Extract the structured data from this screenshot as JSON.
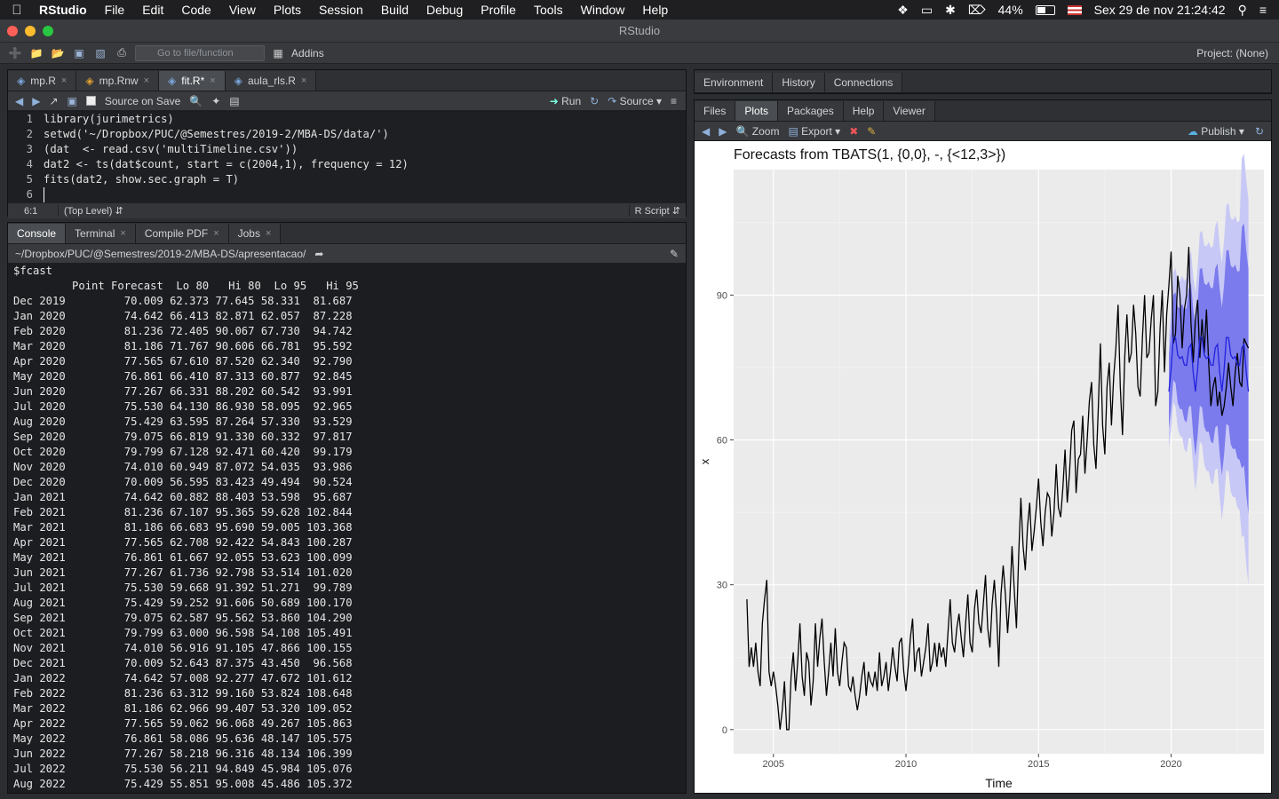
{
  "menubar": {
    "app": "RStudio",
    "items": [
      "File",
      "Edit",
      "Code",
      "View",
      "Plots",
      "Session",
      "Build",
      "Debug",
      "Profile",
      "Tools",
      "Window",
      "Help"
    ],
    "battery": "44%",
    "datetime": "Sex 29 de nov  21:24:42"
  },
  "window": {
    "title": "RStudio"
  },
  "toolbar": {
    "goto_placeholder": "Go to file/function",
    "addins": "Addins",
    "project": "Project: (None)"
  },
  "editor": {
    "tabs": [
      {
        "label": "mp.R"
      },
      {
        "label": "mp.Rnw"
      },
      {
        "label": "fit.R*"
      },
      {
        "label": "aula_rls.R"
      }
    ],
    "source_on_save": "Source on Save",
    "run": "Run",
    "source": "Source",
    "lines": [
      "1",
      "2",
      "3",
      "4",
      "5",
      "6"
    ],
    "code": [
      "library(jurimetrics)",
      "setwd('~/Dropbox/PUC/@Semestres/2019-2/MBA-DS/data/')",
      "(dat  <- read.csv('multiTimeline.csv'))",
      "dat2 <- ts(dat$count, start = c(2004,1), frequency = 12)",
      "fits(dat2, show.sec.graph = T)",
      ""
    ],
    "cursor_pos": "6:1",
    "scope": "(Top Level)",
    "filetype": "R Script"
  },
  "console": {
    "tabs": [
      {
        "label": "Console"
      },
      {
        "label": "Terminal"
      },
      {
        "label": "Compile PDF"
      },
      {
        "label": "Jobs"
      }
    ],
    "path": "~/Dropbox/PUC/@Semestres/2019-2/MBA-DS/apresentacao/",
    "lines": [
      "$fcast",
      "         Point Forecast  Lo 80   Hi 80  Lo 95   Hi 95",
      "Dec 2019         70.009 62.373 77.645 58.331  81.687",
      "Jan 2020         74.642 66.413 82.871 62.057  87.228",
      "Feb 2020         81.236 72.405 90.067 67.730  94.742",
      "Mar 2020         81.186 71.767 90.606 66.781  95.592",
      "Apr 2020         77.565 67.610 87.520 62.340  92.790",
      "May 2020         76.861 66.410 87.313 60.877  92.845",
      "Jun 2020         77.267 66.331 88.202 60.542  93.991",
      "Jul 2020         75.530 64.130 86.930 58.095  92.965",
      "Aug 2020         75.429 63.595 87.264 57.330  93.529",
      "Sep 2020         79.075 66.819 91.330 60.332  97.817",
      "Oct 2020         79.799 67.128 92.471 60.420  99.179",
      "Nov 2020         74.010 60.949 87.072 54.035  93.986",
      "Dec 2020         70.009 56.595 83.423 49.494  90.524",
      "Jan 2021         74.642 60.882 88.403 53.598  95.687",
      "Feb 2021         81.236 67.107 95.365 59.628 102.844",
      "Mar 2021         81.186 66.683 95.690 59.005 103.368",
      "Apr 2021         77.565 62.708 92.422 54.843 100.287",
      "May 2021         76.861 61.667 92.055 53.623 100.099",
      "Jun 2021         77.267 61.736 92.798 53.514 101.020",
      "Jul 2021         75.530 59.668 91.392 51.271  99.789",
      "Aug 2021         75.429 59.252 91.606 50.689 100.170",
      "Sep 2021         79.075 62.587 95.562 53.860 104.290",
      "Oct 2021         79.799 63.000 96.598 54.108 105.491",
      "Nov 2021         74.010 56.916 91.105 47.866 100.155",
      "Dec 2021         70.009 52.643 87.375 43.450  96.568",
      "Jan 2022         74.642 57.008 92.277 47.672 101.612",
      "Feb 2022         81.236 63.312 99.160 53.824 108.648",
      "Mar 2022         81.186 62.966 99.407 53.320 109.052",
      "Apr 2022         77.565 59.062 96.068 49.267 105.863",
      "May 2022         76.861 58.086 95.636 48.147 105.575",
      "Jun 2022         77.267 58.218 96.316 48.134 106.399",
      "Jul 2022         75.530 56.211 94.849 45.984 105.076",
      "Aug 2022         75.429 55.851 95.008 45.486 105.372"
    ]
  },
  "env_pane": {
    "tabs": [
      {
        "label": "Environment"
      },
      {
        "label": "History"
      },
      {
        "label": "Connections"
      }
    ]
  },
  "plots_pane": {
    "tabs": [
      {
        "label": "Files"
      },
      {
        "label": "Plots"
      },
      {
        "label": "Packages"
      },
      {
        "label": "Help"
      },
      {
        "label": "Viewer"
      }
    ],
    "zoom": "Zoom",
    "export": "Export",
    "publish": "Publish"
  },
  "chart_data": {
    "type": "line",
    "title": "Forecasts from TBATS(1, {0,0}, -, {<12,3>})",
    "xlabel": "Time",
    "ylabel": "x",
    "xlim": [
      2003.5,
      2023.5
    ],
    "ylim": [
      -5,
      116
    ],
    "xticks": [
      "2005",
      "2010",
      "2015",
      "2020"
    ],
    "yticks": [
      "0",
      "30",
      "60",
      "90"
    ],
    "grid": true,
    "colors": {
      "history": "#000000",
      "forecast": "#2222dd",
      "band80": "#7b7bee",
      "band95": "#c8c8f6",
      "panel": "#ebebeb"
    },
    "series": [
      {
        "start": 2004.0,
        "freq": 12,
        "values": [
          27,
          13,
          17,
          13,
          18,
          12,
          9,
          22,
          27,
          31,
          12,
          9,
          12,
          9,
          5,
          0,
          4,
          10,
          0,
          0,
          11,
          16,
          8,
          14,
          22,
          11,
          7,
          16,
          14,
          5,
          10,
          22,
          13,
          19,
          23,
          14,
          7,
          12,
          18,
          11,
          21,
          12,
          9,
          14,
          18,
          17,
          9,
          8,
          11,
          7,
          4,
          7,
          11,
          14,
          7,
          12,
          10,
          9,
          12,
          8,
          16,
          9,
          11,
          14,
          8,
          12,
          17,
          13,
          10,
          18,
          19,
          12,
          8,
          13,
          19,
          23,
          12,
          16,
          17,
          11,
          14,
          17,
          22,
          12,
          14,
          18,
          13,
          18,
          15,
          17,
          13,
          20,
          27,
          18,
          16,
          21,
          24,
          19,
          15,
          22,
          28,
          18,
          16,
          25,
          29,
          22,
          20,
          26,
          32,
          21,
          17,
          26,
          31,
          24,
          13,
          28,
          34,
          28,
          20,
          27,
          38,
          29,
          21,
          36,
          48,
          38,
          33,
          42,
          47,
          37,
          41,
          46,
          52,
          43,
          38,
          45,
          49,
          48,
          40,
          45,
          55,
          46,
          44,
          50,
          58,
          47,
          53,
          62,
          64,
          49,
          56,
          57,
          65,
          53,
          60,
          68,
          72,
          59,
          54,
          66,
          80,
          63,
          57,
          71,
          76,
          63,
          73,
          79,
          88,
          71,
          61,
          77,
          86,
          76,
          78,
          88,
          82,
          71,
          69,
          81,
          90,
          77,
          78,
          85,
          90,
          67,
          70,
          83,
          91,
          74,
          86,
          92,
          99,
          80,
          82,
          94,
          90,
          79,
          87,
          90,
          100,
          84,
          76,
          85,
          89,
          77,
          85,
          78,
          87,
          76,
          67,
          71,
          73,
          67,
          70,
          65,
          67,
          71,
          76,
          71,
          67,
          74,
          78,
          72,
          71,
          81,
          80,
          79
        ]
      },
      {
        "start": 2019.9167,
        "freq": 12,
        "forecast": [
          70.009,
          74.642,
          81.236,
          81.186,
          77.565,
          76.861,
          77.267,
          75.53,
          75.429,
          79.075,
          79.799,
          74.01,
          70.009,
          74.642,
          81.236,
          81.186,
          77.565,
          76.861,
          77.267,
          75.53,
          75.429,
          79.075,
          79.799,
          74.01,
          70.009,
          74.642,
          81.236,
          81.186,
          77.565,
          76.861,
          77.267,
          75.53,
          75.429,
          79.075,
          79.799,
          74.01,
          70.009
        ]
      }
    ]
  }
}
